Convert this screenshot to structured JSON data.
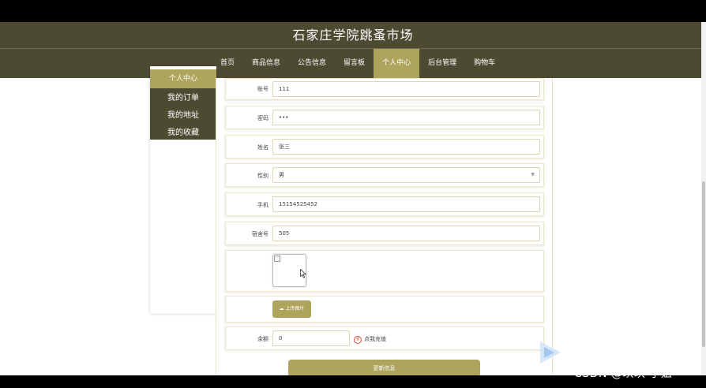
{
  "header": {
    "title": "石家庄学院跳蚤市场"
  },
  "nav": {
    "items": [
      {
        "label": "首页"
      },
      {
        "label": "商品信息"
      },
      {
        "label": "公告信息"
      },
      {
        "label": "留言板"
      },
      {
        "label": "个人中心",
        "active": true
      },
      {
        "label": "后台管理"
      },
      {
        "label": "购物车"
      }
    ]
  },
  "sidebar": {
    "header": "个人中心",
    "items": [
      {
        "label": "我的订单"
      },
      {
        "label": "我的地址"
      },
      {
        "label": "我的收藏"
      }
    ]
  },
  "form": {
    "account": {
      "label": "账号",
      "value": "111"
    },
    "password": {
      "label": "密码",
      "value": "•••"
    },
    "name": {
      "label": "姓名",
      "value": "张三"
    },
    "gender": {
      "label": "性别",
      "value": "男"
    },
    "phone": {
      "label": "手机",
      "value": "15154525452"
    },
    "dorm": {
      "label": "宿舍号",
      "value": "505"
    },
    "upload_label": "上传图片",
    "balance": {
      "label": "余额",
      "value": "0"
    },
    "recharge_label": "点我充值",
    "update_label": "更新信息"
  },
  "watermark": "CSDN @琪琪 学姐",
  "colors": {
    "header_bg": "#4d4a32",
    "accent": "#aea45c",
    "recharge": "#d04a3a"
  }
}
